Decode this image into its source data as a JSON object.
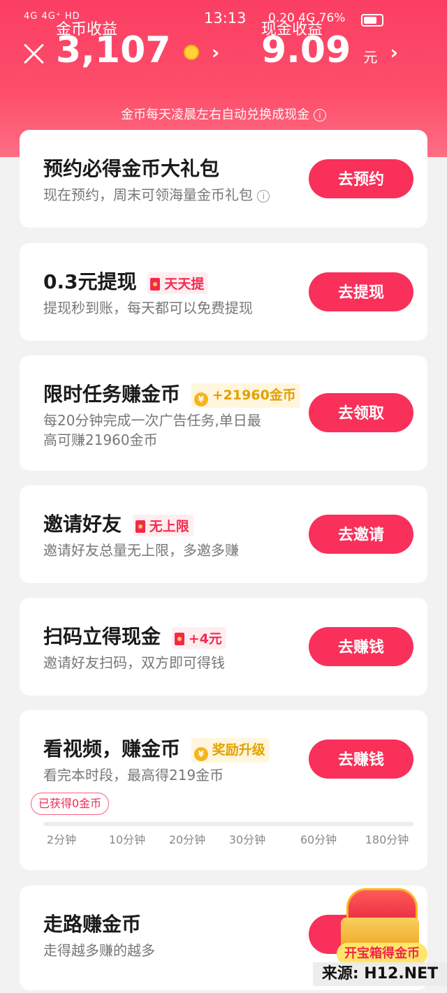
{
  "status_bar": {
    "left": "4G 4G⁺ HD",
    "time": "13:13",
    "right": "0.20  4G 76%"
  },
  "header": {
    "coin_label": "金币收益",
    "coin_value": "3,107",
    "cash_label": "现金收益",
    "cash_value": "9.09",
    "cash_unit": "元",
    "notice": "金币每天凌晨左右自动兑换成现金"
  },
  "cards": [
    {
      "title": "预约必得金币大礼包",
      "sub": "现在预约，周末可领海量金币礼包",
      "button": "去预约"
    },
    {
      "title": "0.3元提现",
      "badge": "天天提",
      "sub": "提现秒到账，每天都可以免费提现",
      "button": "去提现"
    },
    {
      "title": "限时任务赚金币",
      "badge": "+21960金币",
      "sub_line1": "每20分钟完成一次广告任务,单日最",
      "sub_line2": "高可赚21960金币",
      "button": "去领取"
    },
    {
      "title": "邀请好友",
      "badge": "无上限",
      "sub": "邀请好友总量无上限，多邀多赚",
      "button": "去邀请"
    },
    {
      "title": "扫码立得现金",
      "badge": "+4元",
      "sub": "邀请好友扫码，双方即可得钱",
      "button": "去赚钱"
    },
    {
      "title": "看视频，赚金币",
      "badge": "奖励升级",
      "sub": "看完本时段，最高得219金币",
      "button": "去赚钱",
      "progress_label": "已获得0金币",
      "progress": 0,
      "ticks": [
        "2分钟",
        "10分钟",
        "20分钟",
        "30分钟",
        "60分钟",
        "180分钟"
      ]
    },
    {
      "title": "走路赚金币",
      "sub": "走得越多赚的越多"
    }
  ],
  "chest_label": "开宝箱得金币",
  "watermark": "来源: H12.NET",
  "colors": {
    "primary": "#f8305a",
    "header_top": "#fb3e63",
    "gold": "#e3a000"
  }
}
